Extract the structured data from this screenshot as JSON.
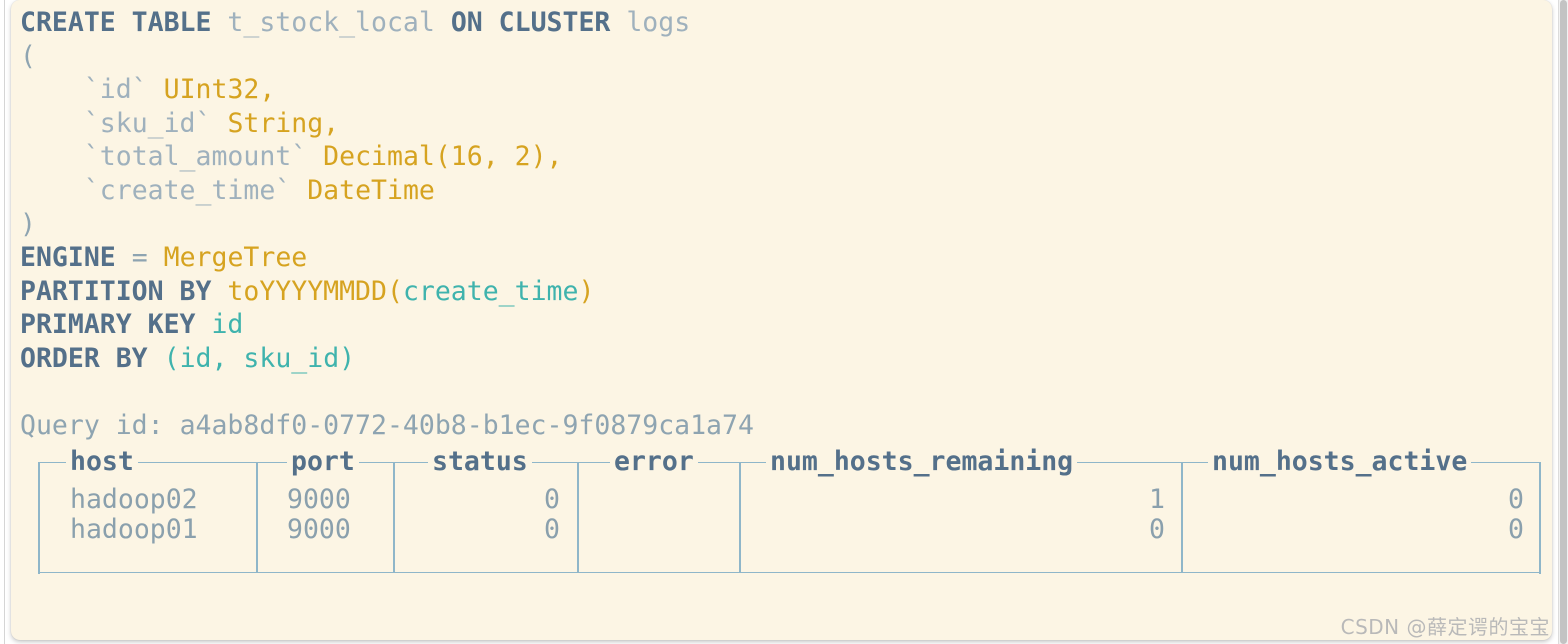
{
  "theme": {
    "page_background": "#ffffff",
    "code_background": "#fcf5e4",
    "keyword_color": "#54708a",
    "identifier_color": "#9fb1bd",
    "type_color": "#d6a320",
    "function_color": "#d6a320",
    "column_color": "#3fb3ad",
    "text_color": "#8aa0ad",
    "table_border_color": "#8fb6c9",
    "watermark_color": "#b9b9b9"
  },
  "terminal": {
    "sql": {
      "line1": {
        "kw_create_table": "CREATE TABLE",
        "table_name": "t_stock_local",
        "kw_on_cluster": "ON CLUSTER",
        "cluster_name": "logs"
      },
      "open_paren": "(",
      "columns": [
        {
          "name": "`id`",
          "type": "UInt32",
          "comma": ","
        },
        {
          "name": "`sku_id`",
          "type": "String",
          "comma": ","
        },
        {
          "name": "`total_amount`",
          "type": "Decimal(16, 2)",
          "comma": ","
        },
        {
          "name": "`create_time`",
          "type": "DateTime",
          "comma": ""
        }
      ],
      "close_paren": ")",
      "engine_kw": "ENGINE",
      "engine_eq": "=",
      "engine_value": "MergeTree",
      "partition_kw": "PARTITION BY",
      "partition_func": "toYYYYMMDD",
      "partition_open": "(",
      "partition_arg": "create_time",
      "partition_close": ")",
      "primary_key_kw": "PRIMARY KEY",
      "primary_key_value": "id",
      "order_by_kw": "ORDER BY",
      "order_by_open": "(",
      "order_by_arg1": "id",
      "order_by_sep": ", ",
      "order_by_arg2": "sku_id",
      "order_by_close": ")"
    },
    "query_id_label": "Query id:",
    "query_id_value": "a4ab8df0-0772-40b8-b1ec-9f0879ca1a74",
    "result_table": {
      "columns": [
        "host",
        "port",
        "status",
        "error",
        "num_hosts_remaining",
        "num_hosts_active"
      ],
      "rows": [
        {
          "host": "hadoop02",
          "port": "9000",
          "status": "0",
          "error": "",
          "num_hosts_remaining": "1",
          "num_hosts_active": "0"
        },
        {
          "host": "hadoop01",
          "port": "9000",
          "status": "0",
          "error": "",
          "num_hosts_remaining": "0",
          "num_hosts_active": "0"
        }
      ]
    }
  },
  "watermark": {
    "text": "CSDN @薛定谔的宝宝"
  }
}
